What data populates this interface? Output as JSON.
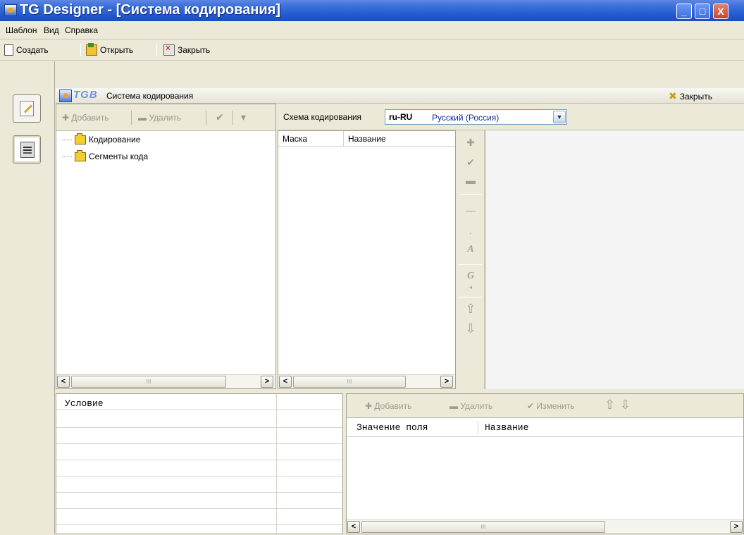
{
  "window": {
    "title": "TG Designer - [Система кодирования]",
    "minimize_glyph": "_",
    "maximize_glyph": "□",
    "close_glyph": "X"
  },
  "menu": [
    "Шаблон",
    "Вид",
    "Справка"
  ],
  "toolbar": {
    "create": "Создать",
    "open": "Открыть",
    "close": "Закрыть"
  },
  "inner_window": {
    "logo_text": "TGB",
    "title": "Система кодирования",
    "close_label": "Закрыть"
  },
  "tree_toolbar": {
    "add": "Добавить",
    "delete": "Удалить"
  },
  "tree": [
    {
      "label": "Кодирование",
      "icon": "folder-open-icon"
    },
    {
      "label": "Сегменты кода",
      "icon": "folder-icon"
    }
  ],
  "scheme": {
    "label": "Схема кодирования",
    "code": "ru-RU",
    "name": "Русский (Россия)"
  },
  "mask_list": {
    "columns": [
      "Маска",
      "Название"
    ]
  },
  "vertical_tools": {
    "a_glyph": "A",
    "g_glyph": "G"
  },
  "conditions": {
    "column": "Условие"
  },
  "values_toolbar": {
    "add": "Добавить",
    "delete": "Удалить",
    "edit": "Изменить"
  },
  "values_table": {
    "columns": [
      "Значение поля",
      "Название"
    ]
  },
  "scroll": {
    "left": "<",
    "right": ">",
    "grip": "III"
  }
}
